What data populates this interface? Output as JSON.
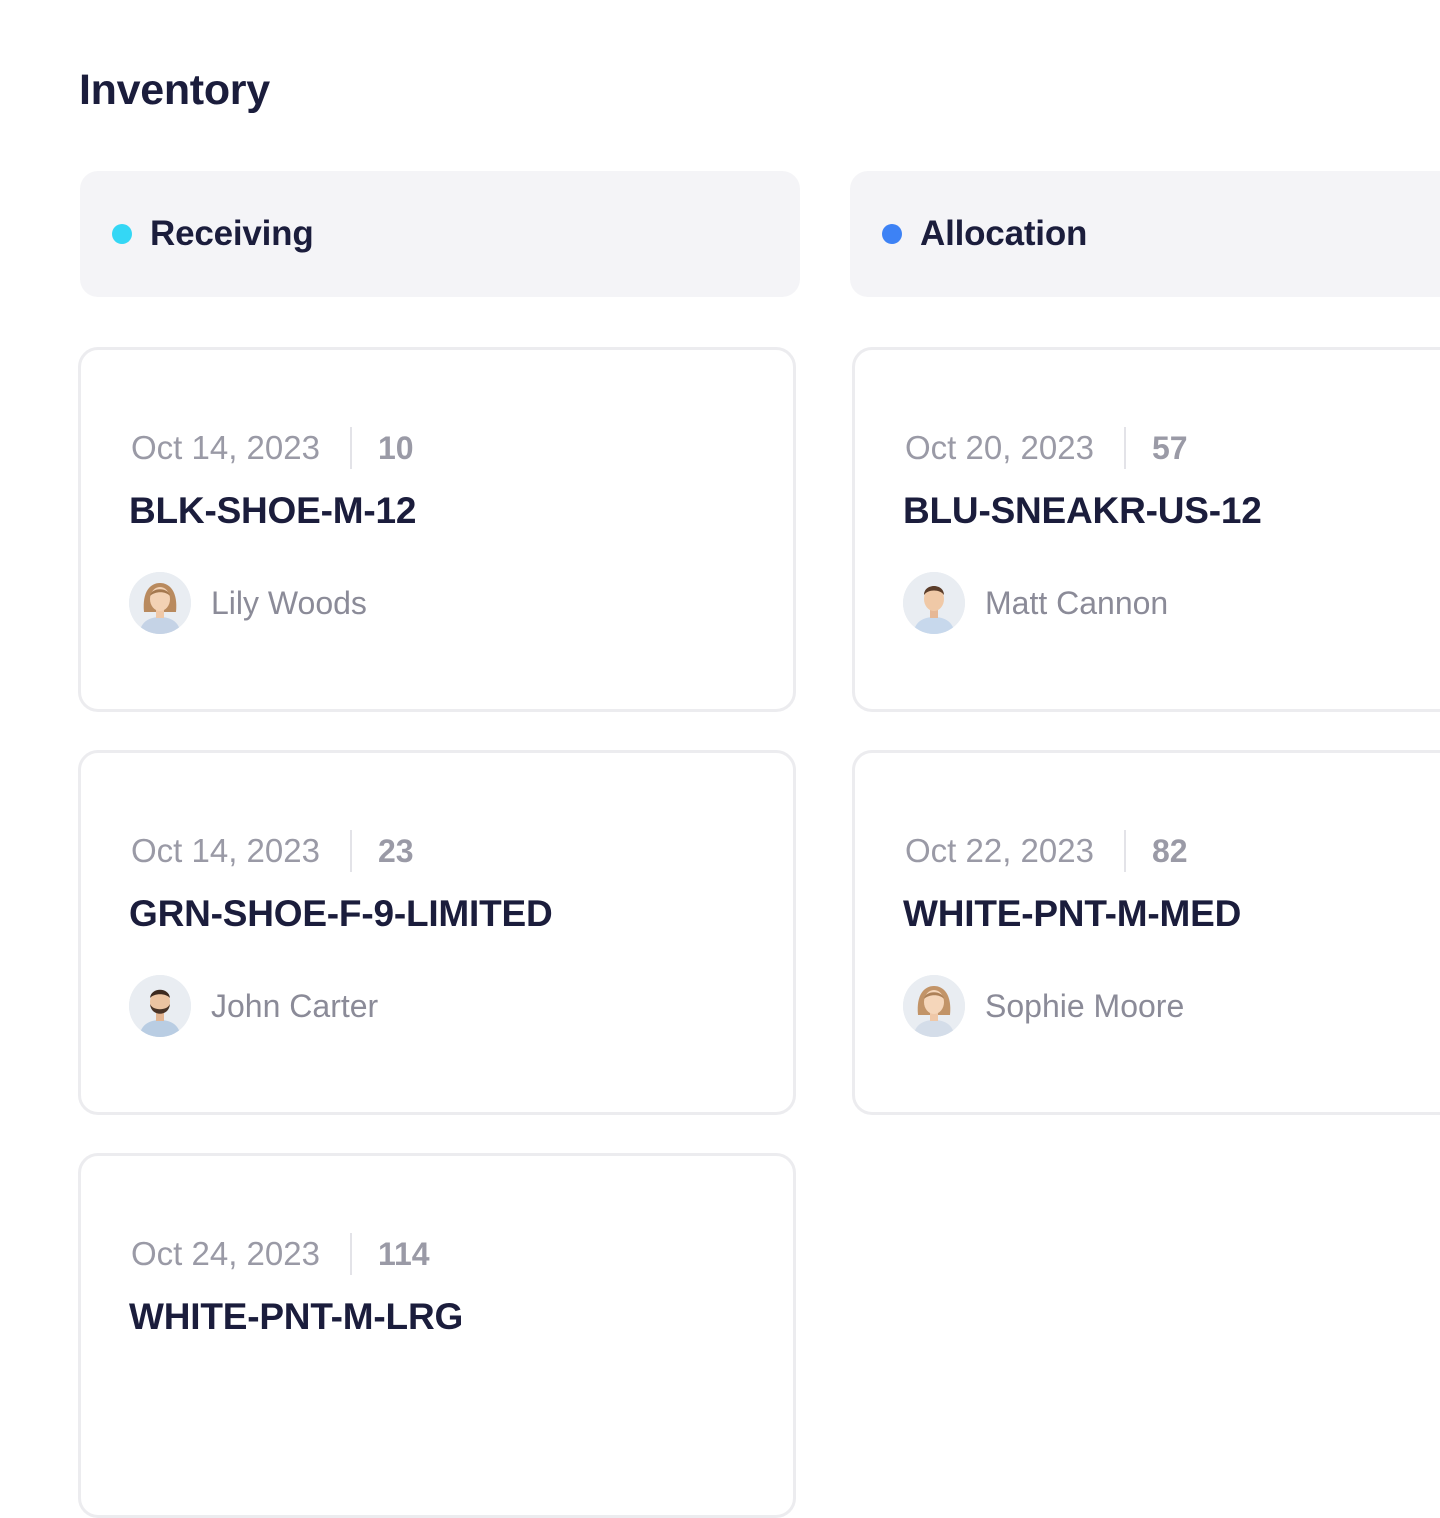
{
  "page": {
    "title": "Inventory"
  },
  "colors": {
    "receiving": "#34d7f5",
    "allocation": "#3d82f5",
    "text_primary": "#1b1d3c",
    "text_muted": "#9a9aa6",
    "header_bg": "#f4f4f7"
  },
  "columns": [
    {
      "title": "Receiving",
      "cards": [
        {
          "date": "Oct 14, 2023",
          "qty": "10",
          "sku": "BLK-SHOE-M-12",
          "owner": "Lily Woods",
          "avatar": "woman-avatar-icon"
        },
        {
          "date": "Oct 14, 2023",
          "qty": "23",
          "sku": "GRN-SHOE-F-9-LIMITED",
          "owner": "John Carter",
          "avatar": "man-beard-avatar-icon"
        },
        {
          "date": "Oct 24, 2023",
          "qty": "114",
          "sku": "WHITE-PNT-M-LRG",
          "owner": "",
          "avatar": ""
        }
      ]
    },
    {
      "title": "Allocation",
      "cards": [
        {
          "date": "Oct 20, 2023",
          "qty": "57",
          "sku": "BLU-SNEAKR-US-12",
          "owner": "Matt Cannon",
          "avatar": "man-avatar-icon"
        },
        {
          "date": "Oct 22, 2023",
          "qty": "82",
          "sku": "WHITE-PNT-M-MED",
          "owner": "Sophie Moore",
          "avatar": "woman-avatar-icon"
        }
      ]
    }
  ]
}
